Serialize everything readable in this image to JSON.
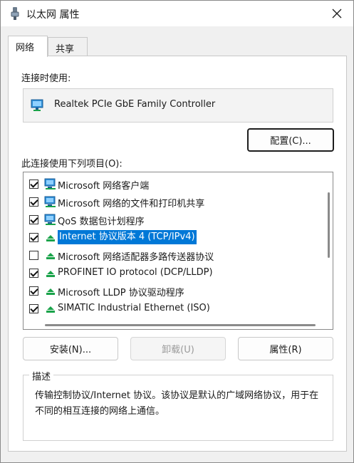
{
  "window": {
    "title": "以太网 属性",
    "close_glyph": "✕"
  },
  "tabs": [
    {
      "label": "网络",
      "active": true
    },
    {
      "label": "共享",
      "active": false
    }
  ],
  "connect_using": {
    "label": "连接时使用:",
    "adapter_name": "Realtek PCIe GbE Family Controller",
    "configure_button": "配置(C)..."
  },
  "items_section": {
    "label": "此连接使用下列项目(O):",
    "items": [
      {
        "label": "Microsoft 网络客户端",
        "checked": true,
        "icon": "network-client-icon"
      },
      {
        "label": "Microsoft 网络的文件和打印机共享",
        "checked": true,
        "icon": "file-printer-sharing-icon"
      },
      {
        "label": "QoS 数据包计划程序",
        "checked": true,
        "icon": "qos-scheduler-icon"
      },
      {
        "label": "Internet 协议版本 4 (TCP/IPv4)",
        "checked": true,
        "selected": true,
        "icon": "protocol-icon"
      },
      {
        "label": "Microsoft 网络适配器多路传送器协议",
        "checked": false,
        "icon": "protocol-icon"
      },
      {
        "label": "PROFINET IO protocol (DCP/LLDP)",
        "checked": true,
        "icon": "protocol-icon"
      },
      {
        "label": "Microsoft LLDP 协议驱动程序",
        "checked": true,
        "icon": "protocol-icon"
      },
      {
        "label": "SIMATIC Industrial Ethernet (ISO)",
        "checked": true,
        "icon": "protocol-icon"
      }
    ]
  },
  "buttons": {
    "install": "安装(N)...",
    "uninstall": "卸载(U)",
    "properties": "属性(R)"
  },
  "description": {
    "title": "描述",
    "text": "传输控制协议/Internet 协议。该协议是默认的广域网络协议，用于在不同的相互连接的网络上通信。"
  },
  "colors": {
    "selection": "#0078d7",
    "accent_icon": "#1aa34a"
  }
}
